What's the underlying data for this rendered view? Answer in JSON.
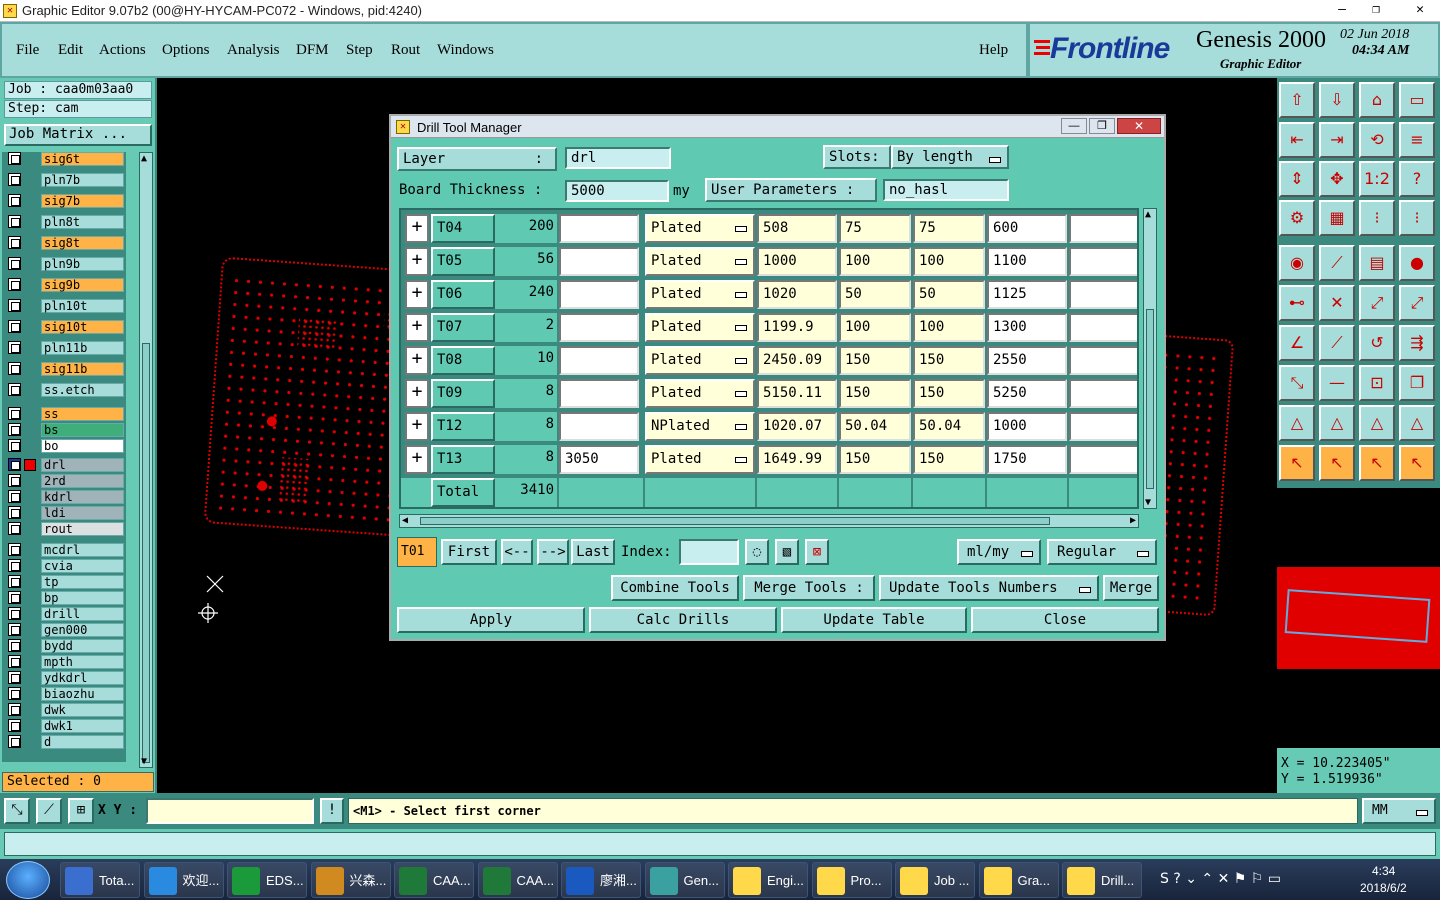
{
  "window": {
    "title": "Graphic Editor 9.07b2 (00@HY-HYCAM-PC072 - Windows, pid:4240)",
    "minimize": "—",
    "maximize": "❐",
    "close": "✕"
  },
  "menu": [
    "File",
    "Edit",
    "Actions",
    "Options",
    "Analysis",
    "DFM",
    "Step",
    "Rout",
    "Windows"
  ],
  "help": "Help",
  "brand": {
    "logo": "Frontline",
    "product": "Genesis 2000",
    "subtitle": "Graphic Editor",
    "date": "02 Jun 2018",
    "time": "04:34 AM"
  },
  "job": {
    "job_line": "Job : caa0m03aa0",
    "step_line": "Step: cam",
    "matrix_button": "Job Matrix ..."
  },
  "layers": [
    {
      "name": "sig6t",
      "color": "#ffb347"
    },
    {
      "name": "pln7b",
      "color": "#a6dcd9"
    },
    {
      "name": "sig7b",
      "color": "#ffb347"
    },
    {
      "name": "pln8t",
      "color": "#a6dcd9"
    },
    {
      "name": "sig8t",
      "color": "#ffb347"
    },
    {
      "name": "pln9b",
      "color": "#a6dcd9"
    },
    {
      "name": "sig9b",
      "color": "#ffb347"
    },
    {
      "name": "pln10t",
      "color": "#a6dcd9"
    },
    {
      "name": "sig10t",
      "color": "#ffb347"
    },
    {
      "name": "pln11b",
      "color": "#a6dcd9"
    },
    {
      "name": "sig11b",
      "color": "#ffb347"
    },
    {
      "name": "ss.etch",
      "color": "#a6dcd9"
    },
    {
      "name": "ss",
      "color": "#ffb347"
    },
    {
      "name": "bs",
      "color": "#3fae7a"
    },
    {
      "name": "bo",
      "color": "#ffffff"
    },
    {
      "name": "drl",
      "color": "#9fb3b8"
    },
    {
      "name": "2rd",
      "color": "#9fb3b8"
    },
    {
      "name": "kdrl",
      "color": "#9fb3b8"
    },
    {
      "name": "ldi",
      "color": "#9fb3b8"
    },
    {
      "name": "rout",
      "color": "#dde0e0"
    },
    {
      "name": "mcdrl",
      "color": "#a6dcd9"
    },
    {
      "name": "cvia",
      "color": "#a6dcd9"
    },
    {
      "name": "tp",
      "color": "#a6dcd9"
    },
    {
      "name": "bp",
      "color": "#a6dcd9"
    },
    {
      "name": "drill",
      "color": "#a6dcd9"
    },
    {
      "name": "gen000",
      "color": "#a6dcd9"
    },
    {
      "name": "bydd",
      "color": "#a6dcd9"
    },
    {
      "name": "mpth",
      "color": "#a6dcd9"
    },
    {
      "name": "ydkdrl",
      "color": "#a6dcd9"
    },
    {
      "name": "biaozhu",
      "color": "#a6dcd9"
    },
    {
      "name": "dwk",
      "color": "#a6dcd9"
    },
    {
      "name": "dwk1",
      "color": "#a6dcd9"
    },
    {
      "name": "d",
      "color": "#a6dcd9"
    }
  ],
  "selected": "Selected : 0",
  "dialog": {
    "title": "Drill Tool Manager",
    "layer_label": "Layer",
    "layer_colon": ":",
    "layer_value": "drl",
    "slots_label": "Slots:",
    "slots_value": "By length",
    "thickness_label": "Board Thickness :",
    "thickness_value": "5000",
    "thickness_unit": "my",
    "user_params_label": "User Parameters :",
    "user_params_value": "no_hasl",
    "rows": [
      {
        "tool": "T04",
        "count": "200",
        "c1": "",
        "type": "Plated",
        "finish": "508",
        "tol_plus": "75",
        "tol_minus": "75",
        "drill": "600",
        "c9": ""
      },
      {
        "tool": "T05",
        "count": "56",
        "c1": "",
        "type": "Plated",
        "finish": "1000",
        "tol_plus": "100",
        "tol_minus": "100",
        "drill": "1100",
        "c9": ""
      },
      {
        "tool": "T06",
        "count": "240",
        "c1": "",
        "type": "Plated",
        "finish": "1020",
        "tol_plus": "50",
        "tol_minus": "50",
        "drill": "1125",
        "c9": ""
      },
      {
        "tool": "T07",
        "count": "2",
        "c1": "",
        "type": "Plated",
        "finish": "1199.9",
        "tol_plus": "100",
        "tol_minus": "100",
        "drill": "1300",
        "c9": ""
      },
      {
        "tool": "T08",
        "count": "10",
        "c1": "",
        "type": "Plated",
        "finish": "2450.09",
        "tol_plus": "150",
        "tol_minus": "150",
        "drill": "2550",
        "c9": ""
      },
      {
        "tool": "T09",
        "count": "8",
        "c1": "",
        "type": "Plated",
        "finish": "5150.11",
        "tol_plus": "150",
        "tol_minus": "150",
        "drill": "5250",
        "c9": ""
      },
      {
        "tool": "T12",
        "count": "8",
        "c1": "",
        "type": "NPlated",
        "finish": "1020.07",
        "tol_plus": "50.04",
        "tol_minus": "50.04",
        "drill": "1000",
        "c9": ""
      },
      {
        "tool": "T13",
        "count": "8",
        "c1": "3050",
        "type": "Plated",
        "finish": "1649.99",
        "tol_plus": "150",
        "tol_minus": "150",
        "drill": "1750",
        "c9": ""
      }
    ],
    "total_label": "Total",
    "total_value": "3410",
    "current_tool": "T01",
    "nav_first": "First",
    "nav_prev": "<--",
    "nav_next": "-->",
    "nav_last": "Last",
    "index_label": "Index:",
    "index_value": "",
    "units": "ml/my",
    "mode": "Regular",
    "combine": "Combine Tools",
    "merge_tools": "Merge Tools :",
    "update_numbers": "Update Tools Numbers",
    "merge": "Merge",
    "apply": "Apply",
    "calc": "Calc Drills",
    "update_table": "Update Table",
    "close": "Close"
  },
  "coords": {
    "x": "X  = 10.223405\"",
    "y": "Y  = 1.519936\""
  },
  "status": {
    "xy_label": "X Y :",
    "xy_value": "",
    "prompt": "<M1> - Select first corner",
    "units": "MM"
  },
  "taskbar": {
    "items": [
      {
        "label": "Tota...",
        "color": "#3a6fd0"
      },
      {
        "label": "欢迎...",
        "color": "#2a8ae0"
      },
      {
        "label": "EDS...",
        "color": "#1a9a3a"
      },
      {
        "label": "兴森...",
        "color": "#d08a20"
      },
      {
        "label": "CAA...",
        "color": "#1f7a3a"
      },
      {
        "label": "CAA...",
        "color": "#1f7a3a"
      },
      {
        "label": "廖湘...",
        "color": "#1a5ac0"
      },
      {
        "label": "Gen...",
        "color": "#3aa0a0"
      },
      {
        "label": "Engi...",
        "color": "#ffd94a"
      },
      {
        "label": "Pro...",
        "color": "#ffd94a"
      },
      {
        "label": "Job ...",
        "color": "#ffd94a"
      },
      {
        "label": "Gra...",
        "color": "#ffd94a"
      },
      {
        "label": "Drill...",
        "color": "#ffd94a"
      }
    ],
    "time": "4:34",
    "date": "2018/6/2"
  },
  "accent": {
    "red": "#e00000",
    "teal": "#67cab4",
    "yellow": "#ffff00"
  }
}
